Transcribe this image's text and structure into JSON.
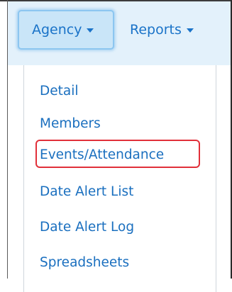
{
  "navbar": {
    "tabs": [
      {
        "label": "Agency",
        "active": true
      },
      {
        "label": "Reports",
        "active": false
      }
    ]
  },
  "dropdown": {
    "items": [
      {
        "label": "Detail"
      },
      {
        "label": "Members"
      },
      {
        "label": "Events/Attendance",
        "highlighted": true
      },
      {
        "label": "Date Alert List"
      },
      {
        "label": "Date Alert Log"
      },
      {
        "label": "Spreadsheets"
      }
    ]
  },
  "colors": {
    "link": "#1a6fbf",
    "navbar_bg": "#e3f1fb",
    "highlight_border": "#e1303a"
  }
}
